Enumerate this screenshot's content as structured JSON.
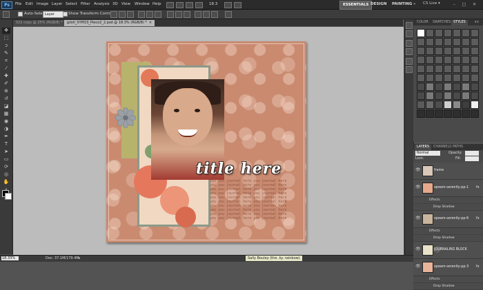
{
  "app": {
    "logo": "Ps"
  },
  "menu": [
    "File",
    "Edit",
    "Image",
    "Layer",
    "Select",
    "Filter",
    "Analysis",
    "3D",
    "View",
    "Window",
    "Help"
  ],
  "menubar": {
    "zoom": "18.3",
    "workspaces": [
      "ESSENTIALS",
      "DESIGN",
      "PAINTING"
    ],
    "more": "»",
    "cs_live": "CS Live ▾",
    "win_min": "–",
    "win_max": "□",
    "win_close": "✕"
  },
  "options": {
    "auto_select_label": "Auto-Select:",
    "auto_select_value": "Layer",
    "transform_label": "Show Transform Controls"
  },
  "tabs": [
    {
      "label": "022 copy @ 25% (RGB/8) *",
      "close": "×"
    },
    {
      "label": "jplstl_SYHO3_Pieco2_2.psd @ 18.3% (RGB/8) *",
      "close": "×"
    }
  ],
  "artwork": {
    "title": "title here",
    "journal_lines": [
      "you you journal here you journal here",
      "you you journal here you journal here",
      "you you journal here you journal here",
      "you you journal here you journal here",
      "you you journal here you journal here",
      "you you journal here you journal here",
      "you you journal here you journal here",
      "you you journal here you journal here",
      "you you journal here you journal here",
      "you you journal here you journal here"
    ]
  },
  "status": {
    "zoom": "18.33%",
    "doc": "Doc: 37.1M/179.4M",
    "more": "▸",
    "tooltip": "Sally Bouley (the .ky. rainbow)"
  },
  "styles_panel": {
    "tabs": [
      "COLOR",
      "SWATCHES",
      "STYLES"
    ],
    "menu": "▾≡"
  },
  "layers_panel": {
    "tabs": [
      "LAYERS",
      "CHANNELS",
      "PATHS"
    ],
    "blend_mode": "Normal",
    "opacity_label": "Opacity:",
    "fill_label": "Fill:",
    "lock_label": "Lock:",
    "eye": "👁",
    "fx": "fx",
    "layers": [
      {
        "name": "frame",
        "effects": null
      },
      {
        "name": "opeam-serenity-pp-1",
        "effects": [
          "Effects",
          "Drop Shadow"
        ]
      },
      {
        "name": "opeam-serenity-pp-6",
        "effects": [
          "Effects",
          "Drop Shadow"
        ]
      },
      {
        "name": "JOURNALING BLOCK",
        "effects": null
      },
      {
        "name": "opeam-serenity-pp-3",
        "effects": [
          "Effects",
          "Drop Shadow"
        ]
      }
    ]
  },
  "watermark": "@",
  "icons": {
    "tools": [
      "move-icon",
      "marquee-icon",
      "lasso-icon",
      "quick-select-icon",
      "crop-icon",
      "eyedropper-icon",
      "healing-icon",
      "brush-icon",
      "clone-stamp-icon",
      "history-brush-icon",
      "eraser-icon",
      "gradient-icon",
      "blur-icon",
      "dodge-icon",
      "pen-icon",
      "type-icon",
      "path-select-icon",
      "shape-icon",
      "3d-rotate-icon",
      "3d-orbit-icon",
      "hand-icon",
      "zoom-icon"
    ],
    "tool_glyphs": [
      "✥",
      "⬚",
      "ↄ",
      "✎",
      "⌗",
      "⁄",
      "✚",
      "✐",
      "⊛",
      "↺",
      "◪",
      "▦",
      "◉",
      "◑",
      "✒",
      "T",
      "➤",
      "▭",
      "⟳",
      "◎",
      "✋",
      "⌕"
    ]
  }
}
